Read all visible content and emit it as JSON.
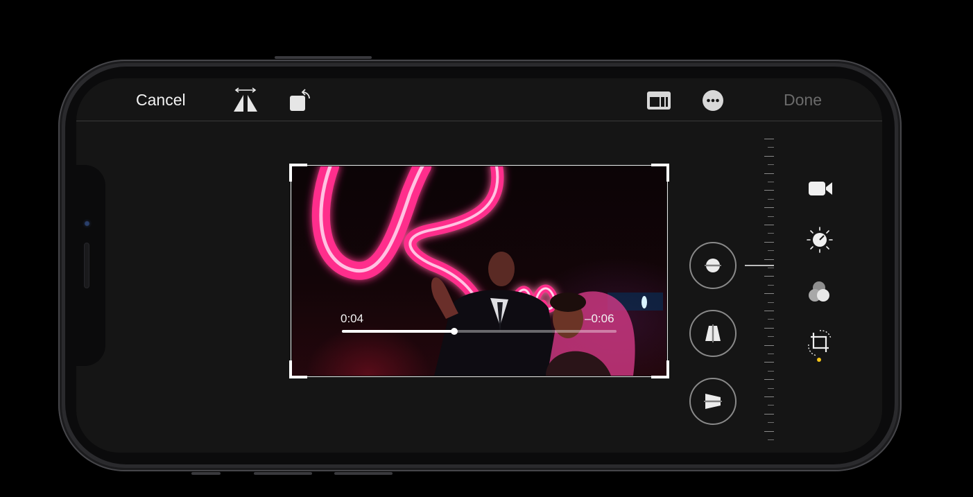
{
  "toolbar": {
    "cancel_label": "Cancel",
    "done_label": "Done",
    "icons": [
      "flip-horizontal-icon",
      "rotate-icon",
      "aspect-ratio-icon",
      "more-icon"
    ]
  },
  "player": {
    "elapsed": "0:04",
    "remaining": "–0:06",
    "progress": 0.41
  },
  "adjustments": [
    "straighten-icon",
    "vertical-perspective-icon",
    "horizontal-perspective-icon"
  ],
  "modes": [
    "video-icon",
    "adjust-icon",
    "filters-icon",
    "crop-icon"
  ],
  "colors": {
    "background": "#000000",
    "screen": "#151515",
    "neon_pink": "#ff2d8c",
    "accent_dot": "#f5c518",
    "done_disabled": "#6b6b6b"
  }
}
